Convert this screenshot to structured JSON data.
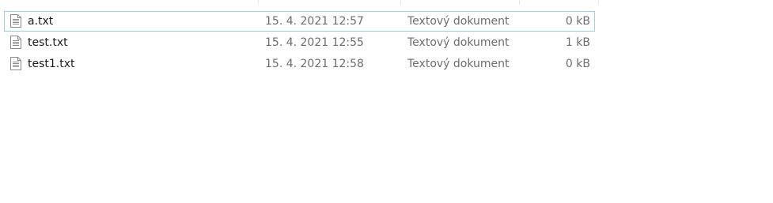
{
  "files": [
    {
      "name": "a.txt",
      "date": "15. 4. 2021 12:57",
      "type": "Textový dokument",
      "size": "0 kB",
      "icon": "text-file-icon",
      "focused": true
    },
    {
      "name": "test.txt",
      "date": "15. 4. 2021 12:55",
      "type": "Textový dokument",
      "size": "1 kB",
      "icon": "text-file-icon",
      "focused": false
    },
    {
      "name": "test1.txt",
      "date": "15. 4. 2021 12:58",
      "type": "Textový dokument",
      "size": "0 kB",
      "icon": "text-file-icon",
      "focused": false
    }
  ],
  "colors": {
    "focus_border": "#99d1ea",
    "name_text": "#1a1a1a",
    "detail_text": "#6d6d6d"
  }
}
